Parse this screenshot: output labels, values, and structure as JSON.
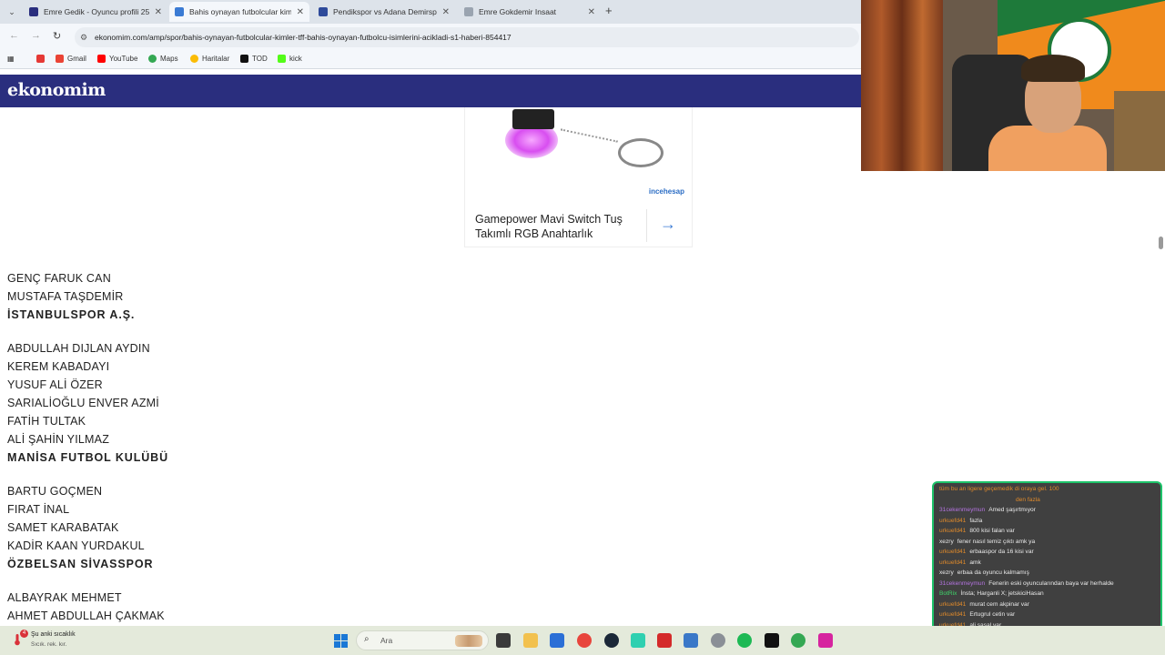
{
  "browser": {
    "tabs": [
      {
        "label": "Emre Gedik - Oyuncu profili 25",
        "active": false
      },
      {
        "label": "Bahis oynayan futbolcular kimle",
        "active": true
      },
      {
        "label": "Pendikspor vs Adana Demirspo",
        "active": false
      },
      {
        "label": "Emre Gokdemir Insaat",
        "active": false
      }
    ],
    "new_tab_label": "+",
    "url": "ekonomim.com/amp/spor/bahis-oynayan-futbolcular-kimler-tff-bahis-oynayan-futbolcu-isimlerini-acikladi-s1-haberi-854417",
    "bookmarks": [
      "Gmail",
      "YouTube",
      "Maps",
      "Haritalar",
      "TOD",
      "kick"
    ]
  },
  "site": {
    "logo": "ekonomim"
  },
  "ad": {
    "brand": "incehesap",
    "title": "Gamepower Mavi Switch Tuş Takımlı RGB Anahtarlık"
  },
  "article": {
    "groups": [
      {
        "players": [
          "GENÇ FARUK CAN",
          "MUSTAFA TAŞDEMİR"
        ],
        "club": "İSTANBULSPOR A.Ş."
      },
      {
        "players": [
          "ABDULLAH DIJLAN AYDIN",
          "KEREM KABADAYI",
          "YUSUF ALİ ÖZER",
          "SARIALİOĞLU ENVER AZMİ",
          "FATİH TULTAK",
          "ALİ ŞAHİN YILMAZ"
        ],
        "club": "MANİSA FUTBOL KULÜBÜ"
      },
      {
        "players": [
          "BARTU GOÇMEN",
          "FIRAT İNAL",
          "SAMET KARABATAK",
          "KADİR KAAN YURDAKUL"
        ],
        "club": "ÖZBELSAN SİVASSPOR"
      },
      {
        "players": [
          "ALBAYRAK MEHMET",
          "AHMET ABDULLAH ÇAKMAK"
        ],
        "club": ""
      }
    ]
  },
  "chat": {
    "messages": [
      {
        "user": "",
        "text": "tüm bu an ligere geçemedik di oraya gel. 100",
        "color": "#e08a2a"
      },
      {
        "user": "",
        "text": "den fazla",
        "color": "#e08a2a",
        "cont": true
      },
      {
        "user": "31cekenmeymun",
        "text": "Amed şaşırtmıyor",
        "color": "#b473e0"
      },
      {
        "user": "urkuefd41",
        "text": "fazla",
        "color": "#e08a2a"
      },
      {
        "user": "urkuefd41",
        "text": "800 kisi falan var",
        "color": "#e08a2a"
      },
      {
        "user": "xezry",
        "text": "fener nasıl temiz çıktı amk ya",
        "color": "#e8e8e8"
      },
      {
        "user": "urkuefd41",
        "text": "erbaaspor da 16 kisi var",
        "color": "#e08a2a"
      },
      {
        "user": "urkuefd41",
        "text": "amk",
        "color": "#e08a2a"
      },
      {
        "user": "xezry",
        "text": "erbaa da oyuncu kalmamış",
        "color": "#e8e8e8"
      },
      {
        "user": "31cekenmeymun",
        "text": "Fenerin eski oyuncularından baya var herhalde",
        "color": "#b473e0"
      },
      {
        "user": "BotRix",
        "text": "İnsta; Harganli X; jetskiciHasan",
        "color": "#3fd46a"
      },
      {
        "user": "urkuefd41",
        "text": "murat cem akpinar var",
        "color": "#e08a2a"
      },
      {
        "user": "urkuefd41",
        "text": "Ertugrul cetin var",
        "color": "#e08a2a"
      },
      {
        "user": "urkuefd41",
        "text": "ali sasal var",
        "color": "#e08a2a"
      },
      {
        "user": "xezry",
        "text": "ESENLER napmış amk",
        "color": "#e8e8e8"
      },
      {
        "user": "xezry",
        "text": "şarkıya bak amk",
        "color": "#e8e8e8"
      }
    ]
  },
  "taskbar": {
    "weather_title": "Şu anki sıcaklık",
    "weather_sub": "Sıcık. rek. kır.",
    "weather_badge": "4",
    "search_placeholder": "Ara"
  },
  "colors": {
    "site_header": "#2a2e7e",
    "chat_border": "#1ec36a",
    "taskbar": "#e4eadb"
  }
}
